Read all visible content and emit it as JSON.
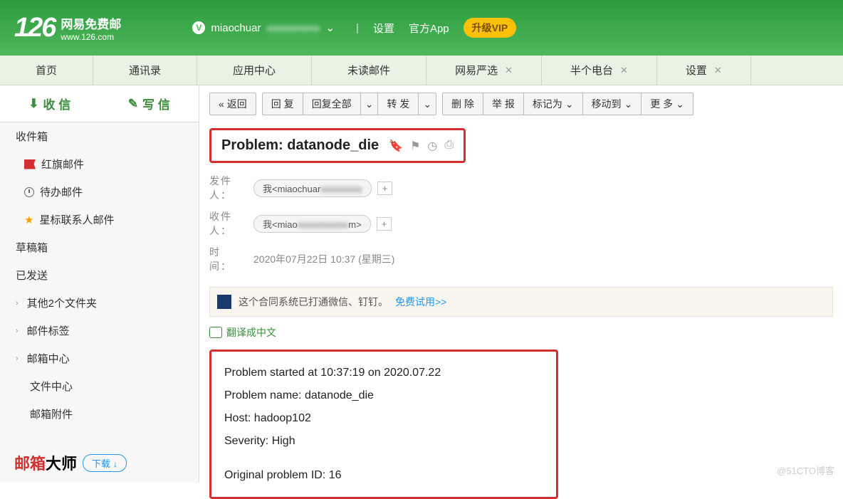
{
  "header": {
    "logo": "126",
    "logo_cn": "网易免费邮",
    "logo_url": "www.126.com",
    "username": "miaochuar",
    "settings": "设置",
    "app": "官方App",
    "vip": "升级VIP"
  },
  "tabs": [
    {
      "label": "首页",
      "closable": false
    },
    {
      "label": "通讯录",
      "closable": false
    },
    {
      "label": "应用中心",
      "closable": false
    },
    {
      "label": "未读邮件",
      "closable": false
    },
    {
      "label": "网易严选",
      "closable": true
    },
    {
      "label": "半个电台",
      "closable": true
    },
    {
      "label": "设置",
      "closable": true
    }
  ],
  "sidebar": {
    "receive": "收 信",
    "compose": "写 信",
    "items": [
      {
        "label": "收件箱",
        "icon": null
      },
      {
        "label": "红旗邮件",
        "icon": "flag"
      },
      {
        "label": "待办邮件",
        "icon": "clock"
      },
      {
        "label": "星标联系人邮件",
        "icon": "star"
      },
      {
        "label": "草稿箱",
        "icon": null
      },
      {
        "label": "已发送",
        "icon": null
      },
      {
        "label": "其他2个文件夹",
        "icon": "chev"
      },
      {
        "label": "邮件标签",
        "icon": "chev"
      },
      {
        "label": "邮箱中心",
        "icon": "chev"
      },
      {
        "label": "文件中心",
        "icon": null
      },
      {
        "label": "邮箱附件",
        "icon": null
      }
    ],
    "master_red": "邮箱",
    "master_black": "大师",
    "download": "下载"
  },
  "toolbar": {
    "back": "返回",
    "reply": "回 复",
    "reply_all": "回复全部",
    "forward": "转 发",
    "delete": "删 除",
    "report": "举 报",
    "mark": "标记为",
    "move": "移动到",
    "more": "更 多"
  },
  "mail": {
    "subject": "Problem: datanode_die",
    "from_label": "发件人：",
    "from": "我<miaochuar",
    "to_label": "收件人：",
    "to_prefix": "我<miao",
    "to_suffix": "m>",
    "time_label": "时　间：",
    "time": "2020年07月22日 10:37 (星期三)"
  },
  "promo": {
    "text": "这个合同系统已打通微信、钉钉。",
    "link": "免费试用>>"
  },
  "translate": "翻译成中文",
  "body": {
    "l1": "Problem started at 10:37:19 on 2020.07.22",
    "l2": "Problem name: datanode_die",
    "l3": "Host: hadoop102",
    "l4": "Severity: High",
    "l5": "Original problem ID: 16"
  },
  "watermark": "@51CTO博客"
}
